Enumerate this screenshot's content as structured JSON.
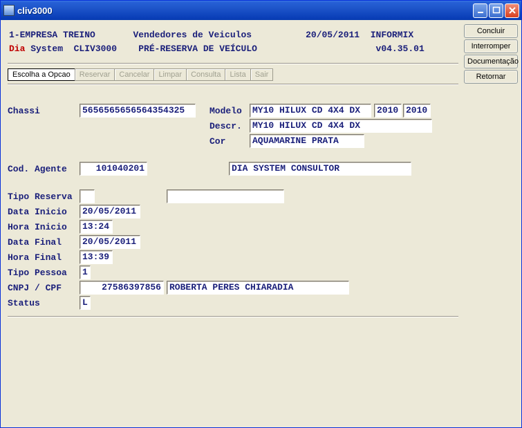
{
  "window": {
    "title": "cliv3000"
  },
  "sidebar": {
    "concluir": "Concluir",
    "interromper": "Interromper",
    "documentacao": "Documentação",
    "retornar": "Retornar"
  },
  "header": {
    "company": "1-EMPRESA TREINO",
    "screen_title": "Vendedores de Veiculos",
    "date": "20/05/2011",
    "db": "INFORMIX",
    "brand_red": "Dia",
    "brand_rest": " System  CLIV3000",
    "subtitle": "PRÉ-RESERVA DE VEÍCULO",
    "version": "v04.35.01"
  },
  "toolbar": {
    "escolha": "Escolha a Opcao",
    "reservar": "Reservar",
    "cancelar": "Cancelar",
    "limpar": "Limpar",
    "consulta": "Consulta",
    "lista": "Lista",
    "sair": "Sair"
  },
  "labels": {
    "chassi": "Chassi",
    "modelo": "Modelo",
    "descr": "Descr.",
    "cor": "Cor",
    "cod_agente": "Cod. Agente",
    "tipo_reserva": "Tipo Reserva",
    "data_inicio": "Data Inicio",
    "hora_inicio": "Hora Inicio",
    "data_final": "Data Final",
    "hora_final": "Hora Final",
    "tipo_pessoa": "Tipo Pessoa",
    "cnpj_cpf": "CNPJ / CPF",
    "status": "Status"
  },
  "values": {
    "chassi": "5656565656564354325",
    "modelo": "MY10 HILUX CD 4X4 DX",
    "ano1": "2010",
    "ano2": "2010",
    "descr": "MY10 HILUX CD 4X4 DX",
    "cor": "AQUAMARINE PRATA",
    "cod_agente": "101040201",
    "agente_nome": "DIA SYSTEM CONSULTOR",
    "tipo_reserva": "",
    "tipo_reserva_desc": "",
    "data_inicio": "20/05/2011",
    "hora_inicio": "13:24",
    "data_final": "20/05/2011",
    "hora_final": "13:39",
    "tipo_pessoa": "1",
    "cnpj_cpf": "27586397856",
    "cpf_nome": "ROBERTA PERES CHIARADIA",
    "status": "L"
  }
}
